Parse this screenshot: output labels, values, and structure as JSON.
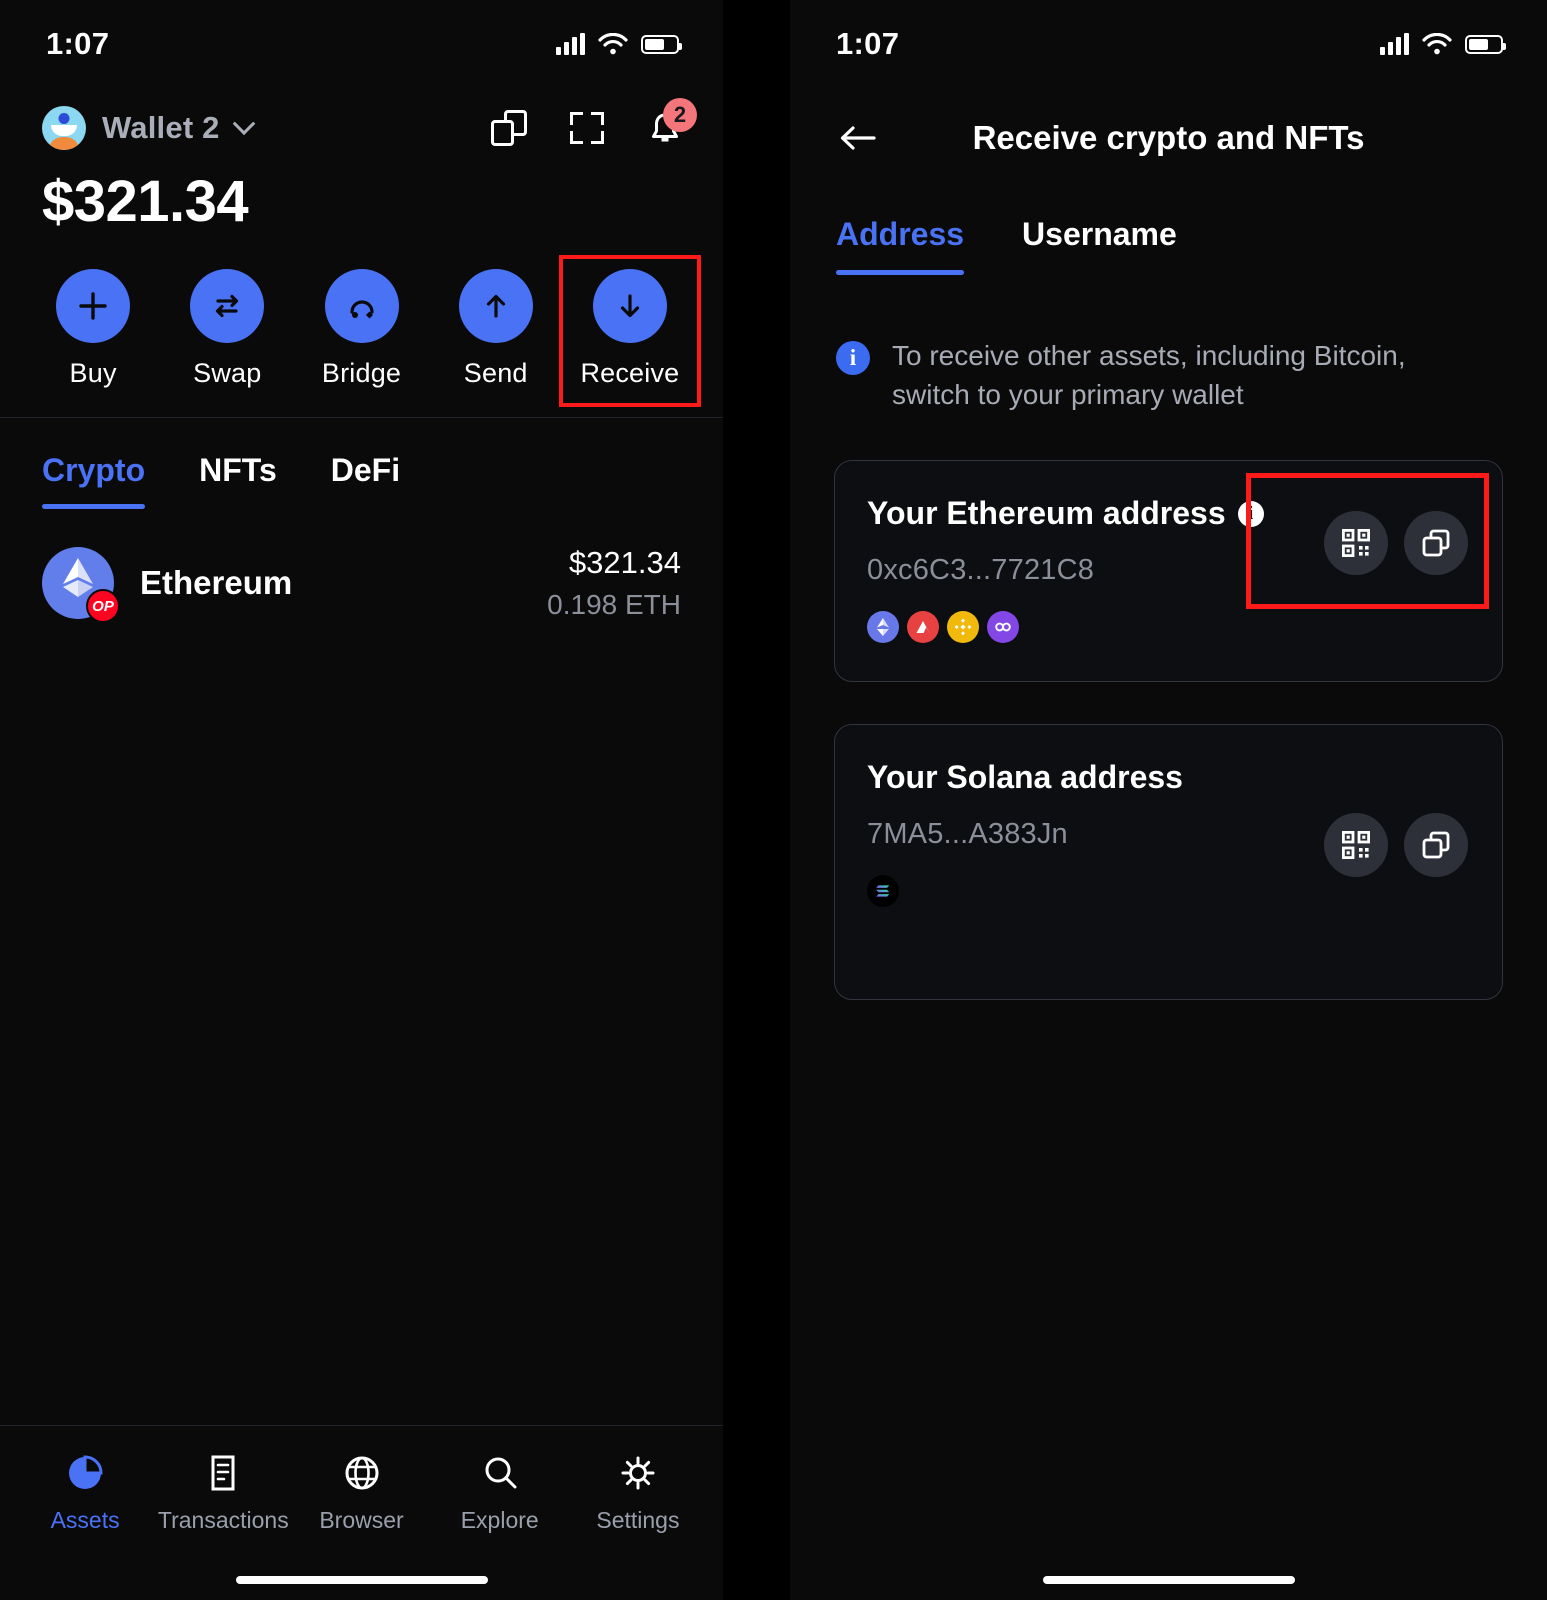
{
  "status_bar": {
    "time": "1:07",
    "signal_icon": "cellular-signal-icon",
    "wifi_icon": "wifi-icon",
    "battery_icon": "battery-icon"
  },
  "left_screen": {
    "wallet": {
      "name": "Wallet 2",
      "avatar_name": "wallet-avatar",
      "chevron": "chevron-down-icon"
    },
    "header_actions": [
      {
        "name": "copy-address-button",
        "icon": "copy-icon"
      },
      {
        "name": "scan-qr-button",
        "icon": "scan-frame-icon"
      },
      {
        "name": "notifications-button",
        "icon": "bell-icon",
        "badge": "2"
      }
    ],
    "balance": "$321.34",
    "actions": [
      {
        "label": "Buy",
        "icon": "plus-icon",
        "highlighted": false
      },
      {
        "label": "Swap",
        "icon": "swap-arrows-icon",
        "highlighted": false
      },
      {
        "label": "Bridge",
        "icon": "bridge-arc-icon",
        "highlighted": false
      },
      {
        "label": "Send",
        "icon": "arrow-up-icon",
        "highlighted": false
      },
      {
        "label": "Receive",
        "icon": "arrow-down-icon",
        "highlighted": true
      }
    ],
    "tabs": [
      {
        "label": "Crypto",
        "active": true
      },
      {
        "label": "NFTs",
        "active": false
      },
      {
        "label": "DeFi",
        "active": false
      }
    ],
    "assets": [
      {
        "name": "Ethereum",
        "network_badge": "OP",
        "fiat_value": "$321.34",
        "token_amount": "0.198 ETH",
        "icon": "ethereum-icon"
      }
    ],
    "bottom_nav": [
      {
        "label": "Assets",
        "icon": "pie-chart-icon",
        "active": true
      },
      {
        "label": "Transactions",
        "icon": "list-document-icon",
        "active": false
      },
      {
        "label": "Browser",
        "icon": "globe-icon",
        "active": false
      },
      {
        "label": "Explore",
        "icon": "search-icon",
        "active": false
      },
      {
        "label": "Settings",
        "icon": "gear-icon",
        "active": false
      }
    ]
  },
  "right_screen": {
    "back_icon": "arrow-left-icon",
    "title": "Receive crypto and NFTs",
    "tabs": [
      {
        "label": "Address",
        "active": true
      },
      {
        "label": "Username",
        "active": false
      }
    ],
    "notice": {
      "icon": "info-circle-icon",
      "text": "To receive other assets, including Bitcoin, switch to your primary wallet"
    },
    "cards": [
      {
        "title": "Your Ethereum address",
        "has_info_icon": true,
        "info_icon": "info-circle-icon",
        "address": "0xc6C3...7721C8",
        "chains": [
          {
            "name": "ethereum-chain-icon",
            "color": "#6878E8"
          },
          {
            "name": "avalanche-chain-icon",
            "color": "#E84142"
          },
          {
            "name": "bnb-chain-icon",
            "color": "#F0B90B"
          },
          {
            "name": "polygon-chain-icon",
            "color": "#8247E5"
          }
        ],
        "buttons": [
          {
            "name": "show-qr-code-button",
            "icon": "qr-code-icon"
          },
          {
            "name": "copy-address-button",
            "icon": "copy-icon"
          }
        ],
        "highlighted": true
      },
      {
        "title": "Your Solana address",
        "has_info_icon": false,
        "address": "7MA5...A383Jn",
        "chains": [
          {
            "name": "solana-chain-icon",
            "color": "#000000"
          }
        ],
        "buttons": [
          {
            "name": "show-qr-code-button",
            "icon": "qr-code-icon"
          },
          {
            "name": "copy-address-button",
            "icon": "copy-icon"
          }
        ],
        "highlighted": false
      }
    ]
  },
  "colors": {
    "accent_blue": "#4A72F5",
    "highlight_red": "#FF1A1A",
    "muted_text": "#8B8F99",
    "card_bg": "#0D0E11"
  }
}
